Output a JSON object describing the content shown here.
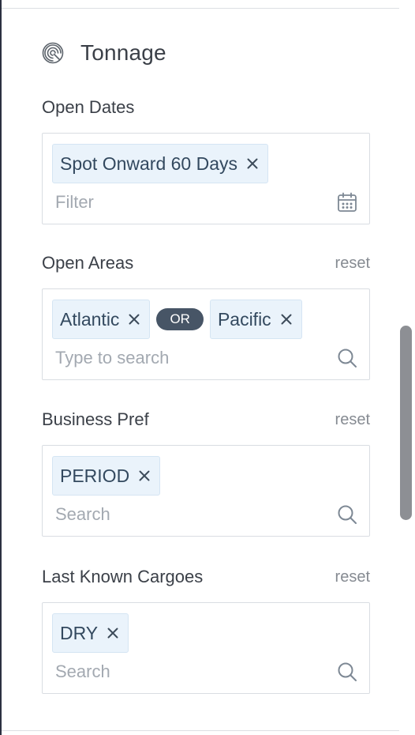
{
  "section": {
    "title": "Tonnage",
    "icon": "tonnage-icon"
  },
  "colors": {
    "chip_bg": "#eaf3fb",
    "chip_border": "#d5e5f3",
    "chip_text": "#33495f",
    "or_pill_bg": "#475566",
    "scroll_thumb": "#8d8f94",
    "label_text": "#3b4048",
    "muted_text": "#868b92"
  },
  "open_dates": {
    "label": "Open Dates",
    "chips": [
      {
        "label": "Spot Onward 60 Days"
      }
    ],
    "placeholder": "Filter",
    "trail_icon": "calendar-icon"
  },
  "open_areas": {
    "label": "Open Areas",
    "reset_label": "reset",
    "chips": [
      {
        "label": "Atlantic"
      },
      {
        "label": "Pacific"
      }
    ],
    "operator": "OR",
    "placeholder": "Type to search",
    "trail_icon": "search-icon"
  },
  "business_pref": {
    "label": "Business Pref",
    "reset_label": "reset",
    "chips": [
      {
        "label": "PERIOD"
      }
    ],
    "placeholder": "Search",
    "trail_icon": "search-icon"
  },
  "last_known_cargoes": {
    "label": "Last Known Cargoes",
    "reset_label": "reset",
    "chips": [
      {
        "label": "DRY"
      }
    ],
    "placeholder": "Search",
    "trail_icon": "search-icon"
  }
}
